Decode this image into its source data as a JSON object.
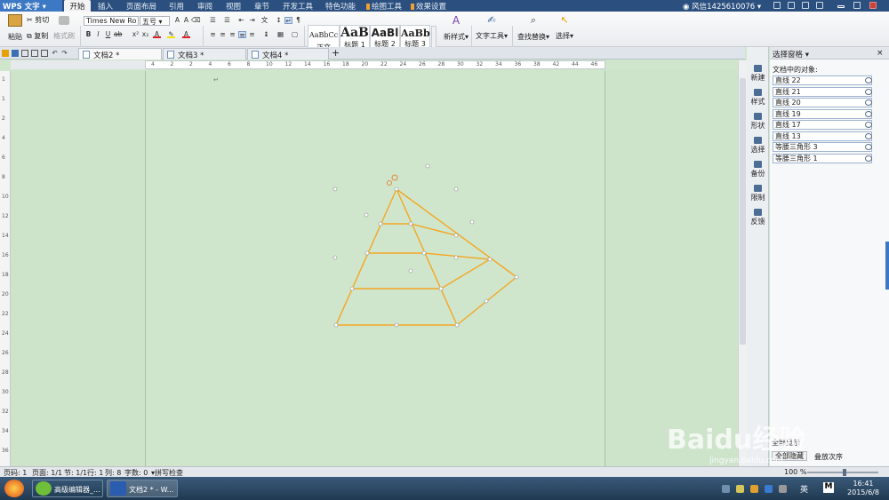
{
  "app": {
    "name": "WPS 文字"
  },
  "menu_tabs": [
    "开始",
    "插入",
    "页面布局",
    "引用",
    "审阅",
    "视图",
    "章节",
    "开发工具",
    "特色功能",
    "绘图工具",
    "效果设置"
  ],
  "user": {
    "label": "风信1425610076"
  },
  "ribbon": {
    "paste": "粘贴",
    "cut": "剪切",
    "copy": "复制",
    "format_painter": "格式刷",
    "font_name": "Times New Ro",
    "font_size": "五号",
    "styles": [
      {
        "preview": "AaBbCc",
        "label": "正文"
      },
      {
        "preview": "AaB",
        "label": "标题 1"
      },
      {
        "preview": "AaBl",
        "label": "标题 2"
      },
      {
        "preview": "AaBb",
        "label": "标题 3"
      }
    ],
    "new_style": "新样式",
    "text_tools": "文字工具",
    "find_replace": "查找替换",
    "select": "选择"
  },
  "doc_tabs": [
    {
      "label": "文档2 *",
      "active": true
    },
    {
      "label": "文档3 *",
      "active": false
    },
    {
      "label": "文档4 *",
      "active": false
    }
  ],
  "ruler": {
    "h_ticks": [
      "4",
      "2",
      "2",
      "4",
      "6",
      "8",
      "10",
      "12",
      "14",
      "16",
      "18",
      "20",
      "22",
      "24",
      "26",
      "28",
      "30",
      "32",
      "34",
      "36",
      "38",
      "42",
      "44",
      "46"
    ],
    "v_ticks": [
      "1",
      "1",
      "2",
      "4",
      "6",
      "8",
      "10",
      "12",
      "14",
      "16",
      "18",
      "20",
      "22",
      "24",
      "26",
      "28",
      "30",
      "32",
      "34",
      "36"
    ]
  },
  "side_tools": [
    "新建",
    "样式",
    "形状",
    "选择",
    "备份",
    "限制",
    "反馈"
  ],
  "selection_pane": {
    "title": "选择窗格",
    "objects_label": "文档中的对象:",
    "objects": [
      "直线 22",
      "直线 21",
      "直线 20",
      "直线 19",
      "直线 17",
      "直线 13",
      "等腰三角形 3",
      "等腰三角形 1"
    ],
    "show_all": "全部显示",
    "hide_all": "全部隐藏",
    "reorder": "叠放次序"
  },
  "status": {
    "page_code": "页码: 1",
    "page": "页面: 1/1",
    "section": "节: 1/1",
    "row": "行: 1",
    "col": "列: 8",
    "word_count": "字数: 0",
    "spell": "拼写检查",
    "zoom": "100 %"
  },
  "taskbar": {
    "tasks": [
      {
        "label": "高级编辑器_..."
      },
      {
        "label": "文档2 * - W..."
      }
    ],
    "ime": "英",
    "time": "16:41",
    "date": "2015/6/8"
  },
  "watermark": {
    "text": "Baidu经验",
    "url": "jingyan.baidu.com"
  },
  "colors": {
    "accent": "#f5a623",
    "titlebar": "#2b4f7e",
    "page": "#cfe6cc"
  }
}
